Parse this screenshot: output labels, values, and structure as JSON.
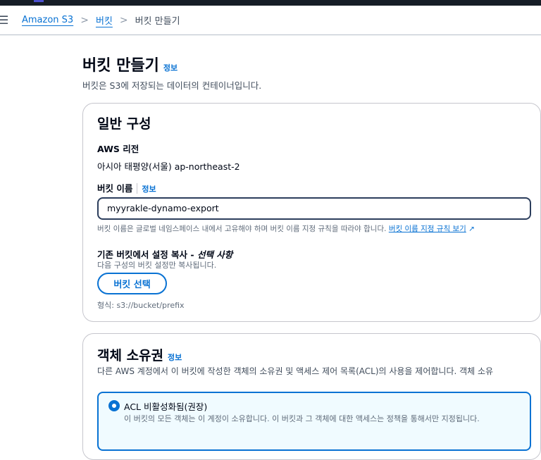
{
  "breadcrumb": {
    "items": [
      "Amazon S3",
      "버킷"
    ],
    "current": "버킷 만들기"
  },
  "page": {
    "title": "버킷 만들기",
    "info": "정보",
    "subtitle": "버킷은 S3에 저장되는 데이터의 컨테이너입니다."
  },
  "general": {
    "title": "일반 구성",
    "region_label": "AWS 리전",
    "region_value": "아시아 태평양(서울) ap-northeast-2",
    "name_label": "버킷 이름",
    "name_info": "정보",
    "name_value": "myyrakle-dynamo-export",
    "name_hint": "버킷 이름은 글로벌 네임스페이스 내에서 고유해야 하며 버킷 이름 지정 규칙을 따라야 합니다.",
    "name_rules_link": "버킷 이름 지정 규칙 보기",
    "copy_label": "기존 버킷에서 설정 복사 - ",
    "copy_optional": "선택 사항",
    "copy_hint": "다음 구성의 버킷 설정만 복사됩니다.",
    "choose_button": "버킷 선택",
    "format_hint": "형식: s3://bucket/prefix"
  },
  "ownership": {
    "title": "객체 소유권",
    "info": "정보",
    "description": "다른 AWS 계정에서 이 버킷에 작성한 객체의 소유권 및 액세스 제어 목록(ACL)의 사용을 제어합니다. 객체 소유",
    "option_label": "ACL 비활성화됨(권장)",
    "option_desc": "이 버킷의 모든 객체는 이 계정이 소유합니다. 이 버킷과 그 객체에 대한 액세스는 정책을 통해서만 지정됩니다."
  }
}
